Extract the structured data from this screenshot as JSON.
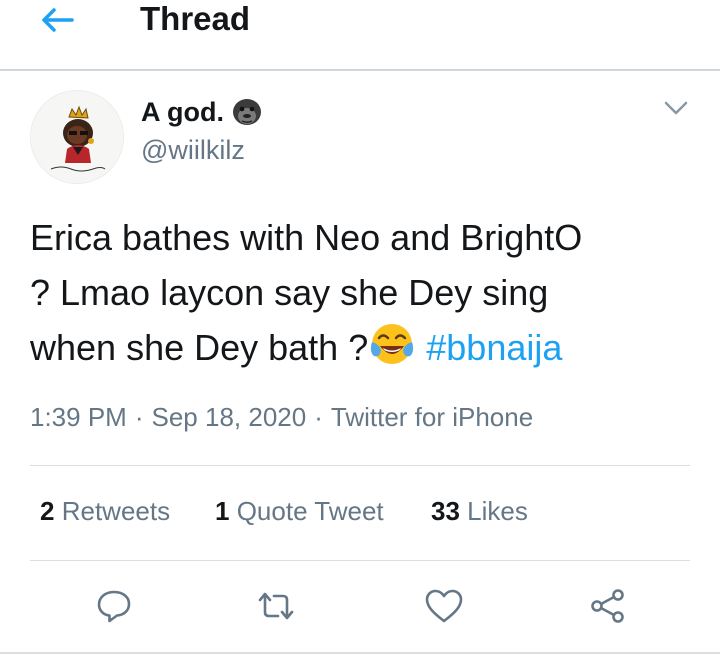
{
  "header": {
    "title": "Thread"
  },
  "tweet": {
    "author_name": "A god.",
    "handle": "@wiilkilz",
    "text_line1": "Erica bathes with Neo and BrightO",
    "text_line2": "? Lmao laycon say she Dey sing",
    "text_line3": "when she Dey bath ?",
    "hashtag": "#bbnaija",
    "time": "1:39 PM",
    "date": "Sep 18, 2020",
    "separator": "·",
    "source": "Twitter for iPhone"
  },
  "stats": {
    "retweets_count": "2",
    "retweets_label": "Retweets",
    "quotes_count": "1",
    "quotes_label": "Quote Tweet",
    "likes_count": "33",
    "likes_label": "Likes"
  },
  "colors": {
    "accent": "#1da1f2",
    "secondary_text": "#657786",
    "primary_text": "#14171a"
  },
  "icons": {
    "back": "arrow-left-icon",
    "author_badge": "gorilla-emoji-icon",
    "menu": "chevron-down-icon",
    "emoji": "face-with-tears-of-joy-icon",
    "reply": "reply-icon",
    "retweet": "retweet-icon",
    "like": "heart-icon",
    "share": "share-icon"
  }
}
